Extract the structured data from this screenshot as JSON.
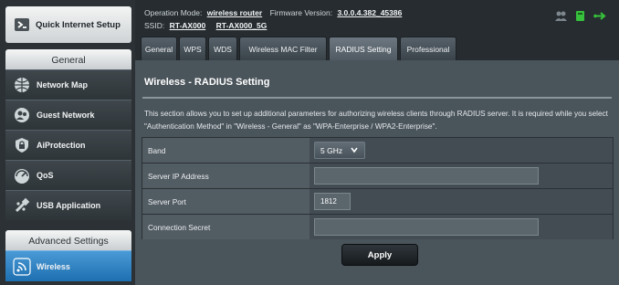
{
  "sidebar": {
    "quick_setup_label": "Quick Internet Setup",
    "general_header": "General",
    "general_items": [
      {
        "label": "Network Map",
        "icon": "network-map-icon"
      },
      {
        "label": "Guest Network",
        "icon": "guest-network-icon"
      },
      {
        "label": "AiProtection",
        "icon": "shield-lock-icon"
      },
      {
        "label": "QoS",
        "icon": "gauge-icon"
      },
      {
        "label": "USB Application",
        "icon": "usb-icon"
      }
    ],
    "advanced_header": "Advanced Settings",
    "advanced_items": [
      {
        "label": "Wireless",
        "icon": "wifi-icon",
        "active": true
      }
    ]
  },
  "topbar": {
    "operation_mode_label": "Operation Mode:",
    "operation_mode_value": "wireless router",
    "firmware_label": "Firmware Version:",
    "firmware_value": "3.0.0.4.382_45386",
    "ssid_label": "SSID:",
    "ssid_1": "RT-AX000",
    "ssid_2": "RT-AX000_5G"
  },
  "tabs": [
    {
      "label": "General"
    },
    {
      "label": "WPS"
    },
    {
      "label": "WDS"
    },
    {
      "label": "Wireless MAC Filter"
    },
    {
      "label": "RADIUS Setting",
      "active": true
    },
    {
      "label": "Professional"
    }
  ],
  "main": {
    "title": "Wireless - RADIUS Setting",
    "description": "This section allows you to set up additional parameters for authorizing wireless clients through RADIUS server. It is required while you select \"Authentication Method\" in \"Wireless - General\" as \"WPA-Enterprise / WPA2-Enterprise\".",
    "fields": {
      "band": {
        "label": "Band",
        "value": "5 GHz"
      },
      "server_ip": {
        "label": "Server IP Address",
        "value": ""
      },
      "server_port": {
        "label": "Server Port",
        "value": "1812"
      },
      "connection_secret": {
        "label": "Connection Secret",
        "value": ""
      }
    },
    "apply_label": "Apply"
  },
  "colors": {
    "accent_blue": "#2f86c9",
    "status_green": "#36c03b",
    "panel_bg": "#4a545b"
  }
}
